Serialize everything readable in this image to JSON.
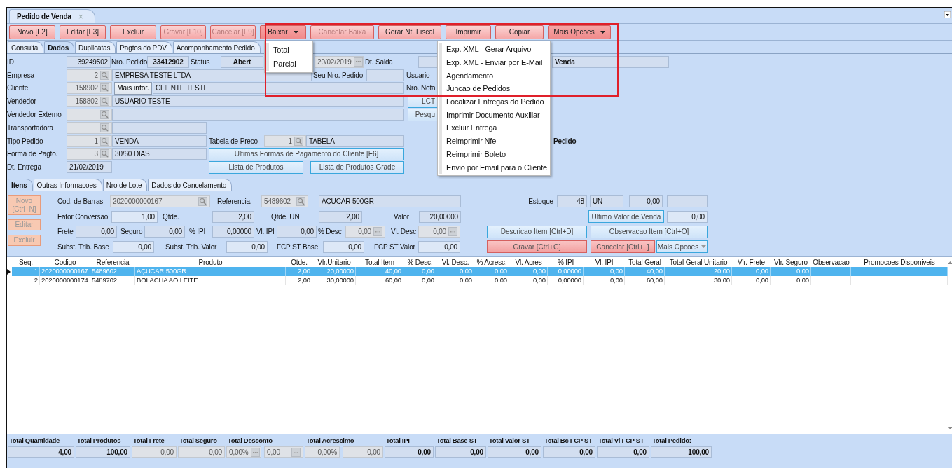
{
  "document_tab": {
    "title": "Pedido de Venda",
    "close": "×"
  },
  "toolbar": [
    {
      "label": "Novo [F2]",
      "disabled": false
    },
    {
      "label": "Editar [F3]",
      "disabled": false
    },
    {
      "label": "Excluir",
      "disabled": false
    },
    {
      "label": "Gravar [F10]",
      "disabled": true
    },
    {
      "label": "Cancelar [F9]",
      "disabled": true
    },
    {
      "label": "Baixar",
      "disabled": false,
      "expanded": true,
      "menu": [
        "Total",
        "Parcial"
      ]
    },
    {
      "label": "Cancelar Baixa",
      "disabled": true
    },
    {
      "label": "Gerar Nt. Fiscal",
      "disabled": false
    },
    {
      "label": "Imprimir",
      "disabled": false
    },
    {
      "label": "Copiar",
      "disabled": false
    },
    {
      "label": "Mais Opcoes",
      "disabled": false,
      "expanded": true,
      "menu": [
        "Exp. XML - Gerar Arquivo",
        "Exp. XML - Enviar por E-Mail",
        "Agendamento",
        "Juncao de Pedidos",
        "Localizar Entregas do Pedido",
        "Imprimir Documento Auxiliar",
        "Excluir Entrega",
        "Reimprimir Nfe",
        "Reimprimir Boleto",
        "Envio por Email para o Cliente"
      ]
    }
  ],
  "tabs": [
    {
      "label": "Consulta",
      "selected": false
    },
    {
      "label": "Dados",
      "selected": true
    },
    {
      "label": "Duplicatas",
      "selected": false
    },
    {
      "label": "Pagtos do PDV",
      "selected": false
    },
    {
      "label": "Acompanhamento Pedido",
      "selected": false
    }
  ],
  "header_rows": [
    [
      {
        "kind": "label",
        "text": "ID"
      },
      {
        "kind": "number",
        "value": "39249502"
      },
      {
        "kind": "label",
        "text": "Nro. Pedido"
      },
      {
        "kind": "strong",
        "value": "33412902"
      },
      {
        "kind": "label",
        "text": "Status"
      },
      {
        "kind": "strong",
        "value": "Abert"
      },
      {
        "kind": "dots",
        "value": "20/02/2019"
      },
      {
        "kind": "label",
        "text": "Dt. Saida"
      },
      {
        "kind": "text"
      },
      {
        "kind": "strong_left",
        "value": "Venda"
      }
    ],
    [
      {
        "kind": "label",
        "text": "Empresa"
      },
      {
        "kind": "lookup",
        "value": "2"
      },
      {
        "kind": "text",
        "value": "EMPRESA TESTE LTDA"
      },
      {
        "kind": "label",
        "text": "Seu Nro. Pedido"
      },
      {
        "kind": "text"
      },
      {
        "kind": "label",
        "text": "Usuario"
      }
    ],
    [
      {
        "kind": "label",
        "text": "Cliente"
      },
      {
        "kind": "lookup",
        "value": "158902"
      },
      {
        "kind": "button",
        "text": "Mais infor."
      },
      {
        "kind": "text",
        "value": "CLIENTE TESTE"
      },
      {
        "kind": "label",
        "text": "Nro. Nota"
      }
    ],
    [
      {
        "kind": "label",
        "text": "Vendedor"
      },
      {
        "kind": "lookup",
        "value": "158802"
      },
      {
        "kind": "text",
        "value": "USUARIO TESTE"
      },
      {
        "kind": "blue_button",
        "text": "LCT"
      }
    ],
    [
      {
        "kind": "label",
        "text": "Vendedor Externo"
      },
      {
        "kind": "lookup"
      },
      {
        "kind": "text"
      },
      {
        "kind": "blue_button",
        "text": "Pesqu"
      }
    ],
    [
      {
        "kind": "label",
        "text": "Transportadora"
      },
      {
        "kind": "lookup"
      },
      {
        "kind": "text"
      }
    ],
    [
      {
        "kind": "label",
        "text": "Tipo Pedido"
      },
      {
        "kind": "lookup",
        "value": "1"
      },
      {
        "kind": "text",
        "value": "VENDA"
      },
      {
        "kind": "label",
        "text": "Tabela de Preco"
      },
      {
        "kind": "lookup",
        "value": "1"
      },
      {
        "kind": "text",
        "value": "TABELA"
      },
      {
        "kind": "label_bold",
        "text": "Pedido"
      }
    ],
    [
      {
        "kind": "label",
        "text": "Forma de Pagto."
      },
      {
        "kind": "lookup",
        "value": "3"
      },
      {
        "kind": "text",
        "value": "30/60 DIAS"
      },
      {
        "kind": "blue_button",
        "text": "Ultimas Formas de Pagamento do Cliente [F6]"
      }
    ],
    [
      {
        "kind": "label",
        "text": "Dt. Entrega"
      },
      {
        "kind": "text",
        "value": "21/02/2019"
      },
      {
        "kind": "blue_button",
        "text": "Lista de Produtos"
      },
      {
        "kind": "blue_button",
        "text": "Lista de Produtos Grade"
      }
    ]
  ],
  "item_tabs": [
    {
      "label": "Itens",
      "selected": true
    },
    {
      "label": "Outras Informacoes",
      "selected": false
    },
    {
      "label": "Nro de Lote",
      "selected": false
    },
    {
      "label": "Dados do Cancelamento",
      "selected": false
    }
  ],
  "item_buttons": [
    {
      "label": "Novo [Ctrl+N]",
      "disabled": true
    },
    {
      "label": "Editar",
      "disabled": true
    },
    {
      "label": "Excluir",
      "disabled": true
    }
  ],
  "item_rows": [
    [
      {
        "kind": "label",
        "text": "Cod. de Barras"
      },
      {
        "kind": "lookup_text",
        "value": "2020000000167"
      },
      {
        "kind": "label",
        "text": "Referencia."
      },
      {
        "kind": "lookup_text",
        "value": "5489602"
      },
      {
        "kind": "text",
        "value": "AÇUCAR 500GR"
      },
      {
        "kind": "label_right",
        "text": "Estoque"
      },
      {
        "kind": "number",
        "value": "48"
      },
      {
        "kind": "text",
        "value": "UN"
      },
      {
        "kind": "number",
        "value": "0,00"
      },
      {
        "kind": "number"
      }
    ],
    [
      {
        "kind": "label",
        "text": "Fator Conversao"
      },
      {
        "kind": "input",
        "value": "1,00"
      },
      {
        "kind": "label",
        "text": "Qtde."
      },
      {
        "kind": "number",
        "value": "2,00"
      },
      {
        "kind": "label",
        "text": "Qtde. UN"
      },
      {
        "kind": "number",
        "value": "2,00"
      },
      {
        "kind": "label",
        "text": "Valor"
      },
      {
        "kind": "number",
        "value": "20,00000"
      },
      {
        "kind": "blue_button",
        "text": "Ultimo Valor de Venda"
      },
      {
        "kind": "input",
        "value": "0,00"
      }
    ],
    [
      {
        "kind": "label",
        "text": "Frete"
      },
      {
        "kind": "number",
        "value": "0,00"
      },
      {
        "kind": "label",
        "text": "Seguro"
      },
      {
        "kind": "number",
        "value": "0,00"
      },
      {
        "kind": "label",
        "text": "% IPI"
      },
      {
        "kind": "number",
        "value": "0,00000"
      },
      {
        "kind": "label",
        "text": "Vl. IPI"
      },
      {
        "kind": "number",
        "value": "0,00"
      },
      {
        "kind": "label",
        "text": "% Desc"
      },
      {
        "kind": "dots",
        "value": "0,00"
      },
      {
        "kind": "label",
        "text": "Vl. Desc"
      },
      {
        "kind": "dots",
        "value": "0,00"
      },
      {
        "kind": "blue_button",
        "text": "Descricao Item [Ctrl+D]"
      },
      {
        "kind": "blue_button",
        "text": "Observacao Item [Ctrl+O]"
      }
    ],
    [
      {
        "kind": "label",
        "text": "Subst. Trib. Base"
      },
      {
        "kind": "input",
        "value": "0,00"
      },
      {
        "kind": "label",
        "text": "Subst. Trib. Valor"
      },
      {
        "kind": "input",
        "value": "0,00"
      },
      {
        "kind": "label",
        "text": "FCP ST Base"
      },
      {
        "kind": "input",
        "value": "0,00"
      },
      {
        "kind": "label",
        "text": "FCP ST Valor"
      },
      {
        "kind": "input",
        "value": "0,00"
      },
      {
        "kind": "red_button",
        "text": "Gravar [Ctrl+G]"
      },
      {
        "kind": "red_button",
        "text": "Cancelar [Ctrl+L]"
      },
      {
        "kind": "drop_button",
        "text": "Mais Opcoes"
      }
    ]
  ],
  "table": {
    "columns": [
      "Seq.",
      "Codigo",
      "Referencia",
      "Produto",
      "Qtde.",
      "Vlr.Unitario",
      "Total Item",
      "% Desc.",
      "Vl. Desc.",
      "% Acresc.",
      "Vl. Acres",
      "% IPI",
      "Vl. IPI",
      "Total Geral",
      "Total Geral Unitario",
      "Vlr. Frete",
      "Vlr. Seguro",
      "Observacao",
      "Promocoes Disponiveis"
    ],
    "rows": [
      {
        "selected": true,
        "cells": [
          "1",
          "2020000000167",
          "5489602",
          "AÇUCAR 500GR",
          "2,00",
          "20,00000",
          "40,00",
          "0,00",
          "0,00",
          "0,00",
          "0,00",
          "0,00000",
          "0,00",
          "40,00",
          "20,00",
          "0,00",
          "0,00"
        ]
      },
      {
        "selected": false,
        "cells": [
          "2",
          "2020000000174",
          "5489702",
          "BOLACHA AO LEITE",
          "2,00",
          "30,00000",
          "60,00",
          "0,00",
          "0,00",
          "0,00",
          "0,00",
          "0,00000",
          "0,00",
          "60,00",
          "30,00",
          "0,00",
          "0,00"
        ]
      }
    ]
  },
  "totals": [
    {
      "label": "Total Quantidade",
      "values": [
        {
          "kind": "total",
          "value": "4,00"
        }
      ]
    },
    {
      "label": "Total Produtos",
      "values": [
        {
          "kind": "total",
          "value": "100,00"
        }
      ]
    },
    {
      "label": "Total Frete",
      "values": [
        {
          "kind": "muted",
          "value": "0,00"
        }
      ]
    },
    {
      "label": "Total Seguro",
      "values": [
        {
          "kind": "muted",
          "value": "0,00"
        }
      ]
    },
    {
      "label": "Total Desconto",
      "values": [
        {
          "kind": "muted_dots",
          "value": "0,00%"
        },
        {
          "kind": "muted_dots",
          "value": "0,00"
        }
      ]
    },
    {
      "label": "Total Acrescimo",
      "values": [
        {
          "kind": "muted",
          "value": "0,00%"
        },
        {
          "kind": "muted",
          "value": "0,00"
        }
      ]
    },
    {
      "label": "Total IPI",
      "values": [
        {
          "kind": "total",
          "value": "0,00"
        }
      ]
    },
    {
      "label": "Total Base ST",
      "values": [
        {
          "kind": "total",
          "value": "0,00"
        }
      ]
    },
    {
      "label": "Total Valor ST",
      "values": [
        {
          "kind": "total",
          "value": "0,00"
        }
      ]
    },
    {
      "label": "Total Bc FCP ST",
      "values": [
        {
          "kind": "total",
          "value": "0,00"
        }
      ]
    },
    {
      "label": "Total Vl FCP ST",
      "values": [
        {
          "kind": "total",
          "value": "0,00"
        }
      ]
    },
    {
      "label": "Total Pedido:",
      "values": [
        {
          "kind": "total",
          "value": "100,00"
        }
      ]
    }
  ]
}
